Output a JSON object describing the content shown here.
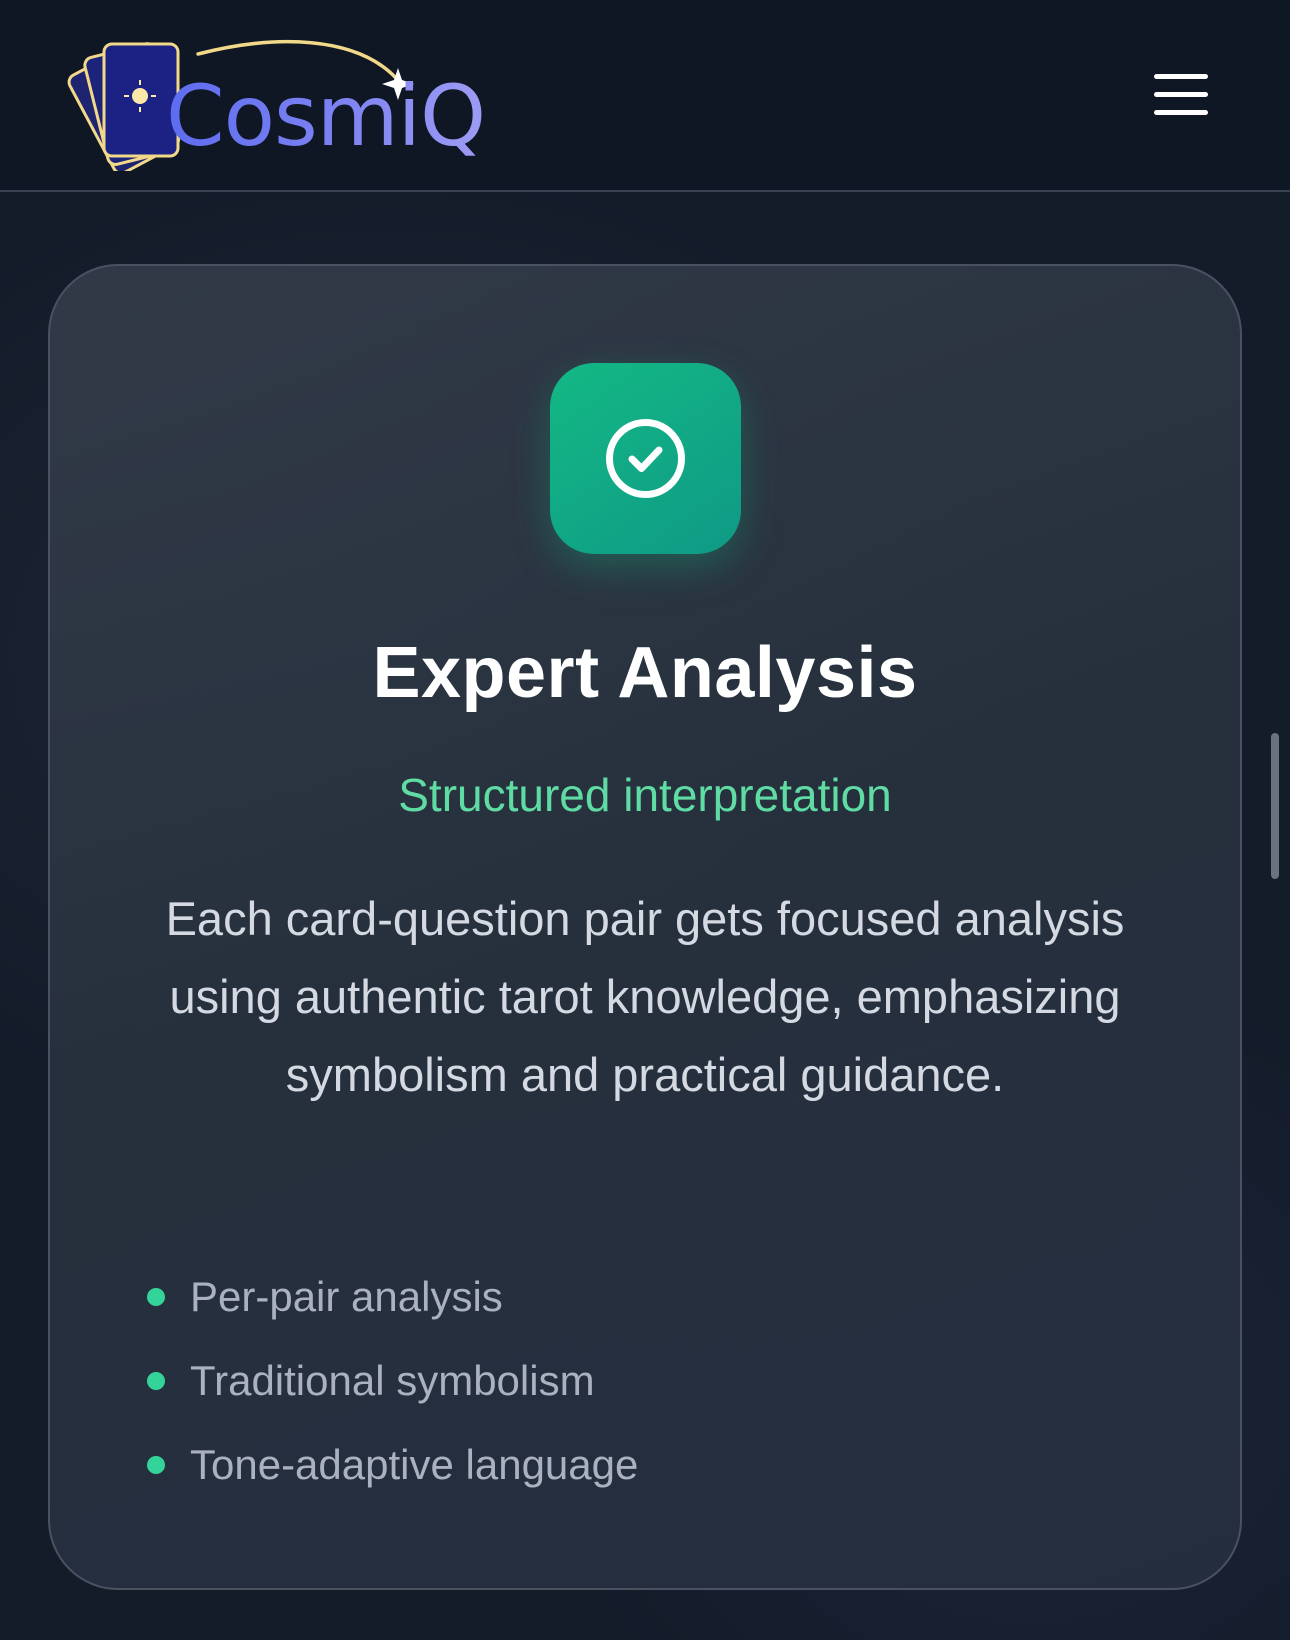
{
  "header": {
    "logo_text": "CosmiQ",
    "menu_icon": "hamburger-menu-icon"
  },
  "card": {
    "icon": "check-circle-icon",
    "title": "Expert Analysis",
    "subtitle": "Structured interpretation",
    "description": "Each card-question pair gets focused analysis using authentic tarot knowledge, emphasizing symbolism and practical guidance.",
    "features": [
      {
        "label": "Per-pair analysis"
      },
      {
        "label": "Traditional symbolism"
      },
      {
        "label": "Tone-adaptive language"
      }
    ]
  },
  "colors": {
    "accent_green": "#34d399",
    "subtitle_green": "#5fdca4",
    "icon_tile": "#10b981",
    "logo_gradient_start": "#5d6cf0",
    "logo_gradient_end": "#9d9cf4",
    "background": "#141b29"
  }
}
